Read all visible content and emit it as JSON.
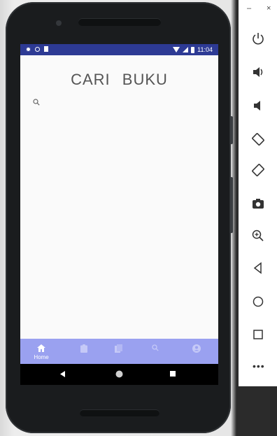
{
  "app": {
    "title": "CARI BUKU",
    "status_bar": {
      "time": "11:04"
    },
    "bottom_nav": {
      "items": [
        {
          "name": "home",
          "label": "Home",
          "icon": "home-icon",
          "active": true
        },
        {
          "name": "clipboard",
          "label": "",
          "icon": "clipboard-icon",
          "active": false
        },
        {
          "name": "books",
          "label": "",
          "icon": "book-icon",
          "active": false
        },
        {
          "name": "search",
          "label": "",
          "icon": "search-icon",
          "active": false
        },
        {
          "name": "account",
          "label": "",
          "icon": "account-icon",
          "active": false
        }
      ]
    },
    "colors": {
      "status_bar": "#2d3a94",
      "bottom_nav": "#9aa1f0",
      "screen_bg": "#fafafa"
    }
  },
  "emulator_toolbar": {
    "window_controls": {
      "minimize": "–",
      "close": "×"
    },
    "buttons": [
      "power-icon",
      "volume-up-icon",
      "volume-down-icon",
      "rotate-left-icon",
      "rotate-right-icon",
      "camera-icon",
      "zoom-in-icon",
      "back-icon",
      "home-icon",
      "overview-icon"
    ],
    "more_label": "•••"
  }
}
